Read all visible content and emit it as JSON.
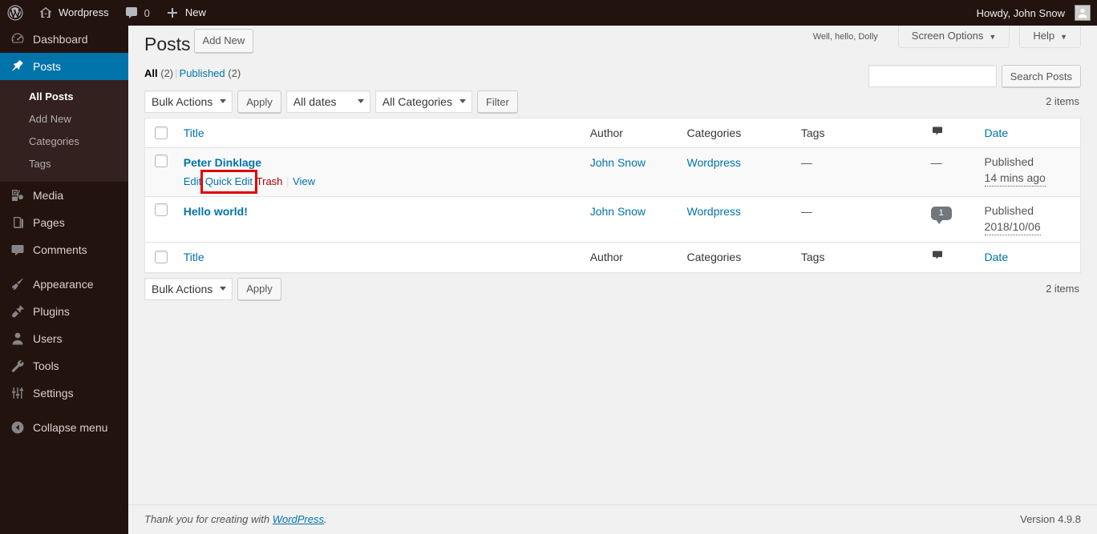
{
  "adminbar": {
    "logo_icon": "wordpress-logo-icon",
    "site_icon": "home-icon",
    "site_name": "Wordpress",
    "comments_icon": "comment-bubble-icon",
    "comments_count": "0",
    "new_icon": "plus-icon",
    "new_label": "New",
    "howdy": "Howdy, John Snow",
    "avatar_icon": "user-avatar-icon"
  },
  "sidebar": {
    "items": [
      {
        "label": "Dashboard",
        "icon": "dashboard-gauge-icon",
        "current": false
      },
      {
        "label": "Posts",
        "icon": "pin-icon",
        "current": true
      },
      {
        "label": "Media",
        "icon": "media-icon",
        "current": false
      },
      {
        "label": "Pages",
        "icon": "pages-icon",
        "current": false
      },
      {
        "label": "Comments",
        "icon": "comment-bubble-icon",
        "current": false
      },
      {
        "label": "Appearance",
        "icon": "paintbrush-icon",
        "current": false
      },
      {
        "label": "Plugins",
        "icon": "plug-icon",
        "current": false
      },
      {
        "label": "Users",
        "icon": "user-icon",
        "current": false
      },
      {
        "label": "Tools",
        "icon": "wrench-icon",
        "current": false
      },
      {
        "label": "Settings",
        "icon": "sliders-icon",
        "current": false
      },
      {
        "label": "Collapse menu",
        "icon": "collapse-arrow-icon",
        "current": false
      }
    ],
    "submenu": [
      {
        "label": "All Posts",
        "current": true
      },
      {
        "label": "Add New",
        "current": false
      },
      {
        "label": "Categories",
        "current": false
      },
      {
        "label": "Tags",
        "current": false
      }
    ]
  },
  "screen_meta": {
    "dolly_text": "Well, hello, Dolly",
    "screen_options_label": "Screen Options",
    "help_label": "Help",
    "caret": "▼"
  },
  "page": {
    "title": "Posts",
    "add_new_label": "Add New"
  },
  "views": {
    "all_label": "All",
    "all_count": "(2)",
    "divider": "|",
    "published_label": "Published",
    "published_count": "(2)"
  },
  "search": {
    "value": "",
    "placeholder": "",
    "submit_label": "Search Posts"
  },
  "tablenav_top": {
    "bulk_actions_label": "Bulk Actions",
    "apply_label": "Apply",
    "dates_label": "All dates",
    "categories_label": "All Categories",
    "filter_label": "Filter",
    "displaying_num": "2 items"
  },
  "tablenav_bottom": {
    "bulk_actions_label": "Bulk Actions",
    "apply_label": "Apply",
    "displaying_num": "2 items"
  },
  "table": {
    "columns": {
      "title": "Title",
      "author": "Author",
      "categories": "Categories",
      "tags": "Tags",
      "comments_icon": "comment-bubble-icon",
      "date": "Date"
    },
    "rows": [
      {
        "title": "Peter Dinklage",
        "actions": {
          "edit": "Edit",
          "quick_edit": "Quick Edit",
          "trash": "Trash",
          "view": "View",
          "separator": "|",
          "highlighted": "Quick Edit"
        },
        "author": "John Snow",
        "categories": "Wordpress",
        "tags": "—",
        "comments": "—",
        "date_status": "Published",
        "date_value": "14 mins ago"
      },
      {
        "title": "Hello world!",
        "actions": null,
        "author": "John Snow",
        "categories": "Wordpress",
        "tags": "—",
        "comments": "1",
        "date_status": "Published",
        "date_value": "2018/10/06"
      }
    ]
  },
  "footer": {
    "thanks_prefix": "Thank you for creating with ",
    "wordpress_link": "WordPress",
    "thanks_suffix": ".",
    "version": "Version 4.9.8"
  },
  "colors": {
    "admin_bar_bg": "#23130f",
    "sidebar_bg": "#23130f",
    "submenu_bg": "#32211e",
    "current_menu_bg": "#0073aa",
    "link": "#0073aa",
    "trash_link": "#a00",
    "highlight_box": "#e00000",
    "content_bg": "#f1f1f1",
    "table_bg": "#ffffff"
  }
}
